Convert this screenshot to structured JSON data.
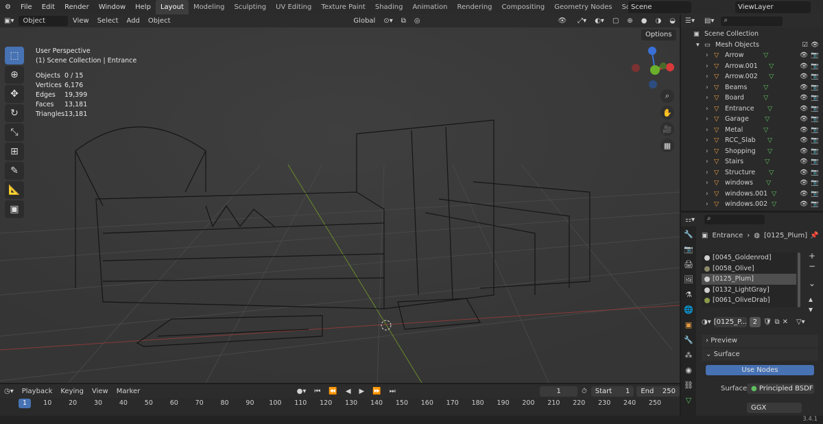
{
  "menus": [
    "File",
    "Edit",
    "Render",
    "Window",
    "Help"
  ],
  "workspaces": [
    "Layout",
    "Modeling",
    "Sculpting",
    "UV Editing",
    "Texture Paint",
    "Shading",
    "Animation",
    "Rendering",
    "Compositing",
    "Geometry Nodes",
    "Scripting"
  ],
  "active_workspace": "Layout",
  "scene": "Scene",
  "view_layer": "ViewLayer",
  "viewport_header": {
    "mode": "Object Mode",
    "view": "View",
    "select": "Select",
    "add": "Add",
    "object": "Object",
    "orientation": "Global",
    "options": "Options"
  },
  "overlay": {
    "perspective": "User Perspective",
    "collection": "(1) Scene Collection | Entrance",
    "stats": [
      {
        "k": "Objects",
        "v": "0 / 15"
      },
      {
        "k": "Vertices",
        "v": "6,176"
      },
      {
        "k": "Edges",
        "v": "19,399"
      },
      {
        "k": "Faces",
        "v": "13,181"
      },
      {
        "k": "Triangles",
        "v": "13,181"
      }
    ]
  },
  "outliner": {
    "root": "Scene Collection",
    "collection": "Mesh Objects",
    "objects": [
      "Arrow",
      "Arrow.001",
      "Arrow.002",
      "Beams",
      "Board",
      "Entrance",
      "Garage",
      "Metal",
      "RCC_Slab",
      "Shopping",
      "Stairs",
      "Structure",
      "windows",
      "windows.001",
      "windows.002"
    ]
  },
  "properties": {
    "object": "Entrance",
    "material": "[0125_Plum]",
    "slots": [
      {
        "name": "[0045_Goldenrod]",
        "color": "#cfcfcf"
      },
      {
        "name": "[0058_Olive]",
        "color": "#8a8a6a"
      },
      {
        "name": "[0125_Plum]",
        "color": "#cfcfcf",
        "selected": true
      },
      {
        "name": "[0132_LightGray]",
        "color": "#d0d0d0"
      },
      {
        "name": "[0061_OliveDrab]",
        "color": "#8b9a4a"
      }
    ],
    "mat_field": "[0125_P...",
    "users": "2",
    "preview": "Preview",
    "surface_panel": "Surface",
    "use_nodes": "Use Nodes",
    "surface_label": "Surface",
    "surface_value": "Principled BSDF",
    "distribution": "GGX"
  },
  "timeline": {
    "playback": "Playback",
    "keying": "Keying",
    "view": "View",
    "marker": "Marker",
    "current": "1",
    "start_label": "Start",
    "start": "1",
    "end_label": "End",
    "end": "250",
    "ticks": [
      "1",
      "10",
      "20",
      "30",
      "40",
      "50",
      "60",
      "70",
      "80",
      "90",
      "100",
      "110",
      "120",
      "130",
      "140",
      "150",
      "160",
      "170",
      "180",
      "190",
      "200",
      "210",
      "220",
      "230",
      "240",
      "250"
    ]
  },
  "version": "3.4.1"
}
